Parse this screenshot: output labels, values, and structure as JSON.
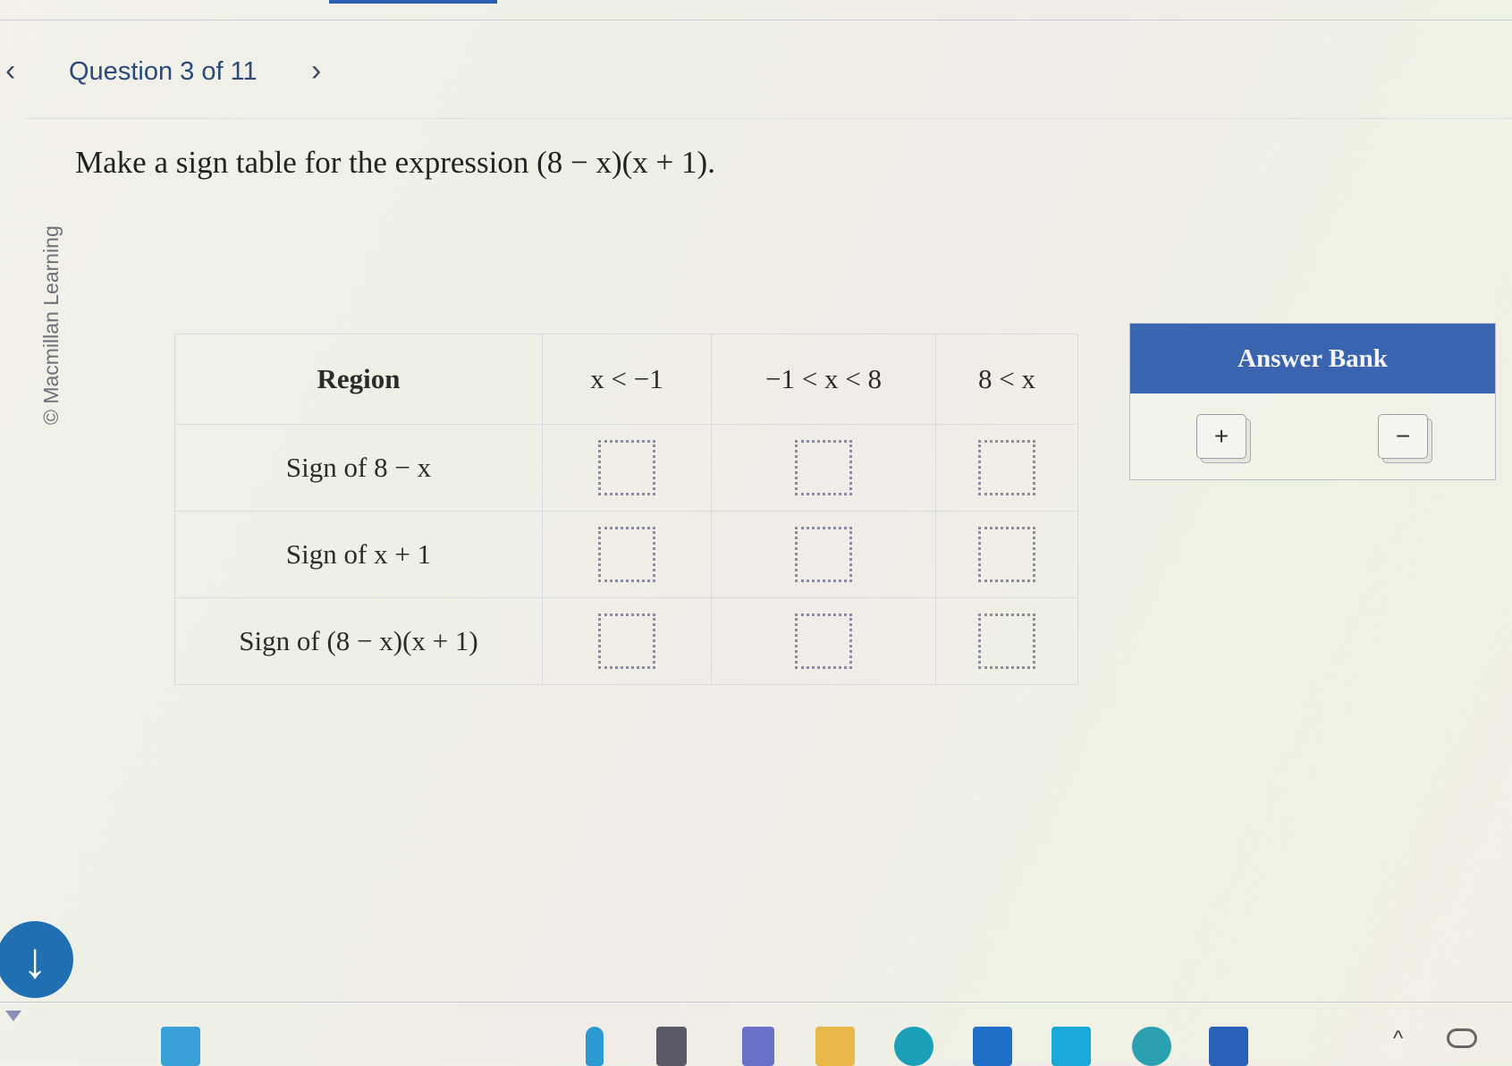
{
  "nav": {
    "prev_icon": "chevron-left-icon",
    "title": "Question 3 of 11",
    "next_icon": "chevron-right-icon"
  },
  "copyright": "© Macmillan Learning",
  "prompt": "Make a sign table for the expression (8 − x)(x + 1).",
  "table": {
    "headers": [
      "Region",
      "x < −1",
      "−1 < x < 8",
      "8 < x"
    ],
    "rows": [
      {
        "label": "Sign of 8 − x",
        "cells": [
          "",
          "",
          ""
        ]
      },
      {
        "label": "Sign of x + 1",
        "cells": [
          "",
          "",
          ""
        ]
      },
      {
        "label": "Sign of (8 − x)(x + 1)",
        "cells": [
          "",
          "",
          ""
        ]
      }
    ]
  },
  "answer_bank": {
    "title": "Answer Bank",
    "items": [
      "+",
      "−"
    ]
  },
  "scroll_down_icon": "arrow-down-icon",
  "taskbar": {
    "icons": [
      "windows-start-icon",
      "search-icon",
      "app-icon",
      "teams-icon",
      "file-explorer-icon",
      "edge-icon",
      "store-icon",
      "app-icon-2",
      "weather-icon",
      "word-icon"
    ],
    "tray_caret": "^",
    "colors": {
      "brand_blue": "#3a64b0",
      "down_button": "#1f6fb2"
    }
  }
}
